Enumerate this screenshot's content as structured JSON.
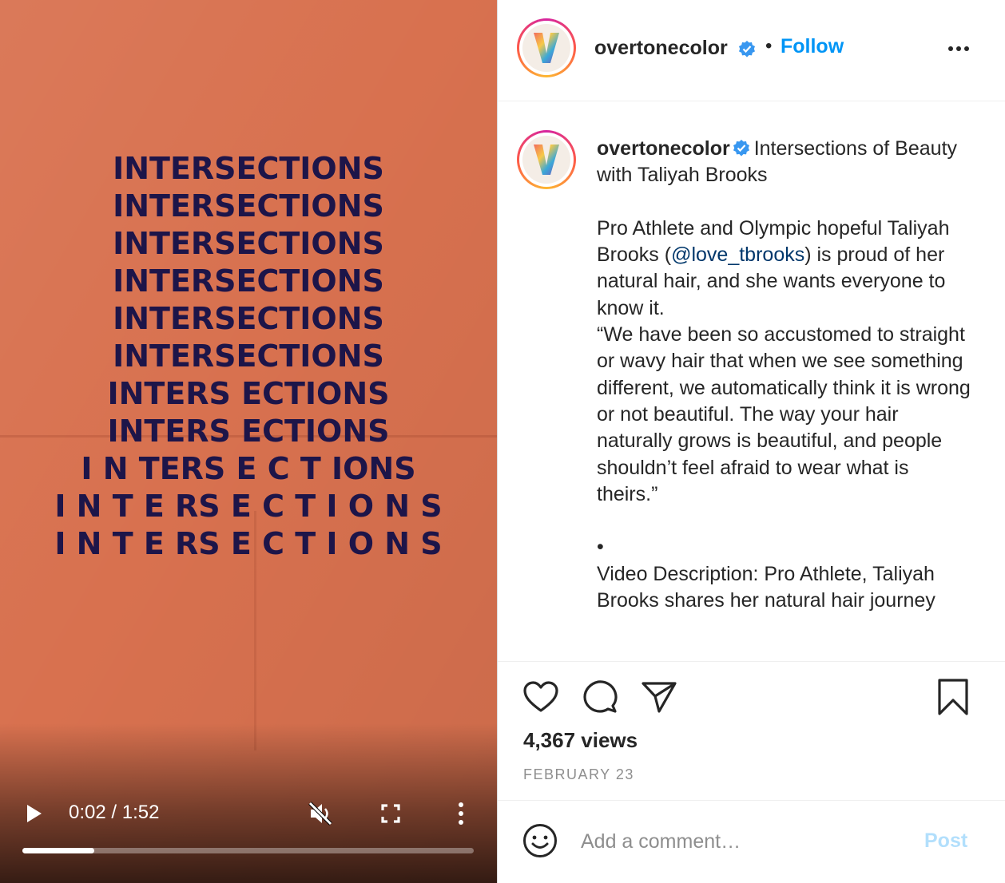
{
  "video": {
    "overlay_rows": [
      "INTERSECTIONS",
      "INTERSECTIONS",
      "INTERSECTIONS",
      "INTERSECTIONS",
      "INTERSECTIONS",
      "INTERSECTIONS",
      "INTERS ECTIONS",
      "INTERS ECTIONS",
      "I N TERS E C T IONS",
      "I N T E RS E C T I O N S",
      "I N T E RS E C T I O N S"
    ],
    "time_display": "0:02 / 1:52",
    "progress": 0.16,
    "muted": true
  },
  "header": {
    "username": "overtonecolor",
    "verified": true,
    "separator": "•",
    "follow_label": "Follow",
    "more_icon": "more-horizontal-icon"
  },
  "caption": {
    "username": "overtonecolor",
    "title_text": "Intersections of Beauty with Taliyah Brooks",
    "para1_before": "Pro Athlete and Olympic hopeful Taliyah Brooks (",
    "mention": "@love_tbrooks",
    "para1_after": ") is proud of her natural hair, and she wants everyone to know it.",
    "quote": "“We have been so accustomed to straight or wavy hair that when we see something different, we automatically think it is wrong or not beautiful. The way your hair naturally grows is beautiful, and people shouldn’t feel afraid to wear what is theirs.”",
    "bullet": "•",
    "description": "Video Description: Pro Athlete, Taliyah Brooks shares her natural hair journey"
  },
  "actions": {
    "like_icon": "heart-icon",
    "comment_icon": "comment-icon",
    "share_icon": "paper-plane-icon",
    "save_icon": "bookmark-icon"
  },
  "stats": {
    "views": "4,367 views",
    "date": "FEBRUARY 23"
  },
  "comment_box": {
    "placeholder": "Add a comment…",
    "post_label": "Post"
  },
  "colors": {
    "video_bg": "#d8714f",
    "overlay_text": "#1d1549",
    "link_blue": "#0095f6",
    "post_disabled": "#b2dffc",
    "verified_blue": "#3897f0"
  }
}
